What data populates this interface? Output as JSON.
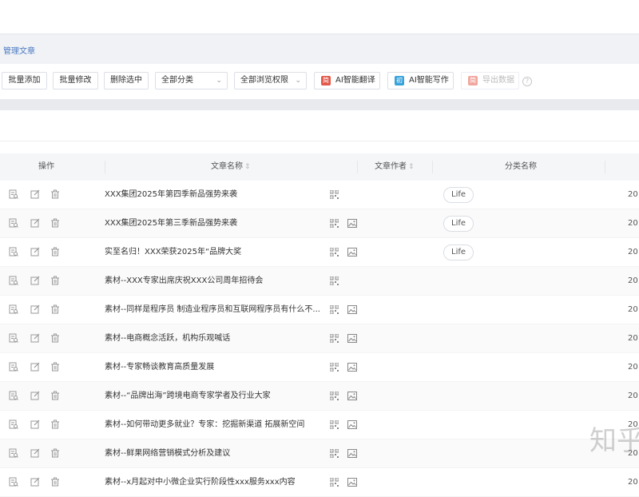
{
  "breadcrumb": "管理文章",
  "toolbar": {
    "batch_add": "批量添加",
    "batch_edit": "批量修改",
    "delete_selected": "删除选中",
    "category_select": "全部分类",
    "permission_select": "全部浏览权限",
    "ai_translate": "AI智能翻译",
    "ai_translate_icon_text": "简",
    "ai_write": "AI智能写作",
    "ai_write_icon_text": "初",
    "export": "导出数据",
    "export_icon_text": "简",
    "help": "?"
  },
  "table": {
    "headers": {
      "actions": "操作",
      "title": "文章名称",
      "author": "文章作者",
      "category": "分类名称",
      "sort_icon": "⇕"
    },
    "rows": [
      {
        "title": "XXX集团2025年第四季新品强势来袭",
        "tag": "Life",
        "date": "20",
        "has_image": false
      },
      {
        "title": "XXX集团2025年第三季新品强势来袭",
        "tag": "Life",
        "date": "20",
        "has_image": true
      },
      {
        "title": "实至名归！XXX荣获2025年“品牌大奖",
        "tag": "Life",
        "date": "20",
        "has_image": true
      },
      {
        "title": "素材--XXX专家出席庆祝XXX公司周年招待会",
        "tag": "",
        "date": "20",
        "has_image": false
      },
      {
        "title": "素材--同样是程序员 制造业程序员和互联网程序员有什么不...",
        "tag": "",
        "date": "20",
        "has_image": true
      },
      {
        "title": "素材--电商概念活跃，机构乐观喊话",
        "tag": "",
        "date": "20",
        "has_image": true
      },
      {
        "title": "素材--专家畅谈教育高质量发展",
        "tag": "",
        "date": "20",
        "has_image": true
      },
      {
        "title": "素材--“品牌出海”跨境电商专家学者及行业大家",
        "tag": "",
        "date": "20",
        "has_image": true
      },
      {
        "title": "素材--如何带动更多就业？专家：挖掘新渠道 拓展新空间",
        "tag": "",
        "date": "20",
        "has_image": true
      },
      {
        "title": "素材--鲜果网络营销模式分析及建议",
        "tag": "",
        "date": "20",
        "has_image": true
      },
      {
        "title": "素材--x月起对中小微企业实行阶段性xxx服务xxx内容",
        "tag": "",
        "date": "20",
        "has_image": true
      }
    ]
  },
  "watermark": "知乎",
  "colors": {
    "accent": "#4a78c2",
    "ai_icon_red": "#e2584a",
    "ai_icon_blue": "#37a2da"
  }
}
